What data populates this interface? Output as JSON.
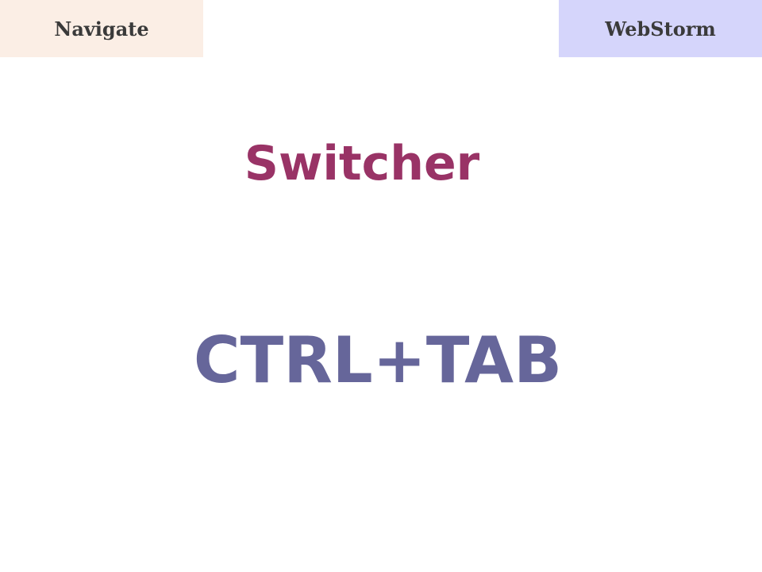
{
  "header": {
    "left_label": "Navigate",
    "right_label": "WebStorm"
  },
  "main": {
    "title": "Switcher",
    "shortcut": "CTRL+TAB"
  },
  "colors": {
    "left_tag_bg": "#fbeee5",
    "right_tag_bg": "#d5d5fb",
    "title": "#993366",
    "shortcut": "#66669a"
  }
}
